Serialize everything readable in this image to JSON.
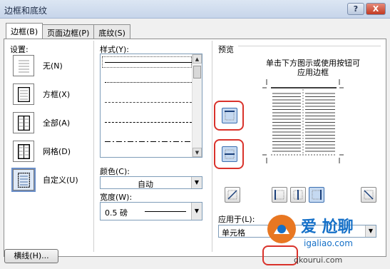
{
  "window": {
    "title": "边框和底纹",
    "help_label": "?",
    "close_label": "X"
  },
  "tabs": [
    {
      "label": "边框(B)",
      "active": true
    },
    {
      "label": "页面边框(P)",
      "active": false
    },
    {
      "label": "底纹(S)",
      "active": false
    }
  ],
  "settings": {
    "label": "设置:",
    "items": [
      {
        "label": "无(N)",
        "icon": "no-border-icon"
      },
      {
        "label": "方框(X)",
        "icon": "box-border-icon"
      },
      {
        "label": "全部(A)",
        "icon": "all-borders-icon"
      },
      {
        "label": "网格(D)",
        "icon": "grid-border-icon"
      },
      {
        "label": "自定义(U)",
        "icon": "custom-border-icon",
        "selected": true
      }
    ]
  },
  "style": {
    "label": "样式(Y):",
    "lines": [
      "solid",
      "dotted",
      "fine-dashed",
      "dashed",
      "dash-dot"
    ]
  },
  "color": {
    "label": "颜色(C):",
    "value": "自动"
  },
  "width": {
    "label": "宽度(W):",
    "value": "0.5 磅"
  },
  "preview": {
    "label": "预览",
    "instruction_line1": "单击下方图示或使用按钮可",
    "instruction_line2": "应用边框",
    "apply_label": "应用于(L):",
    "apply_value": "单元格"
  },
  "buttons": {
    "horizontal_line": "横线(H)..."
  },
  "watermark": {
    "text": "爱 尬聊",
    "url": "igaliao.com",
    "footer": "qkourui.com"
  },
  "colors": {
    "highlight": "#d9322b",
    "selected_btn": "#c5d9f1"
  }
}
